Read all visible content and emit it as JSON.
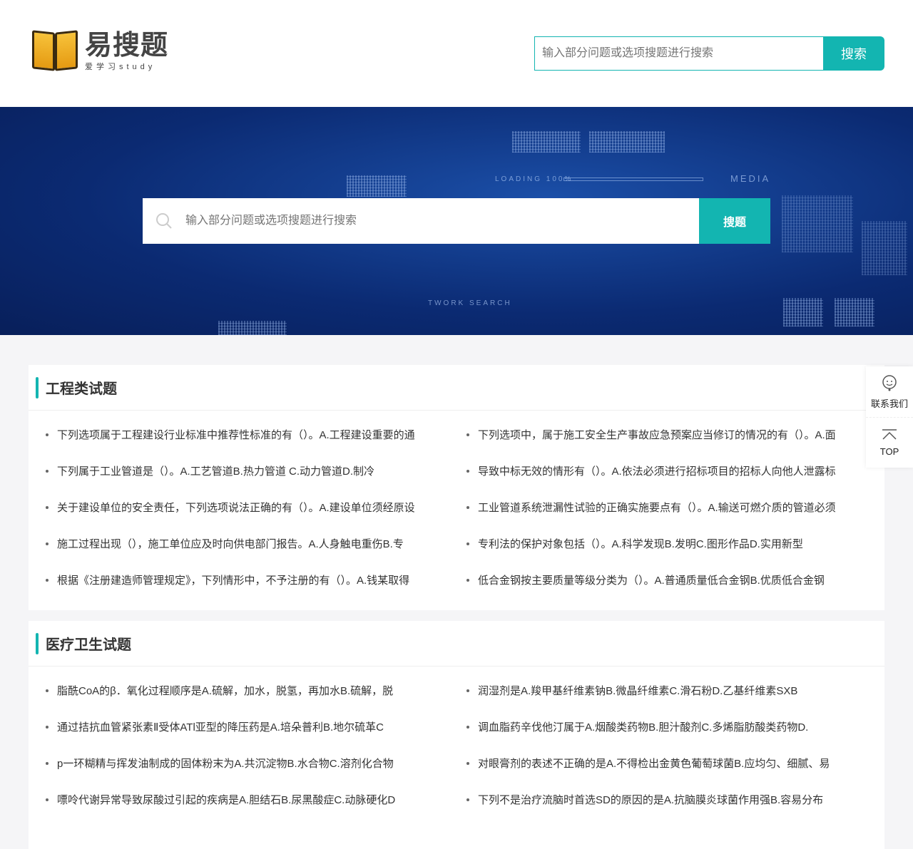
{
  "header": {
    "logo_title": "易搜题",
    "logo_subtitle": "爱学习study",
    "logo_mark": "YS",
    "search_placeholder": "输入部分问题或选项搜题进行搜索",
    "search_button": "搜索"
  },
  "banner": {
    "search_placeholder": "输入部分问题或选项搜题进行搜索",
    "search_button": "搜题",
    "deco_loading": "LOADING 100%",
    "deco_media": "MEDIA",
    "deco_network": "TWORK SEARCH"
  },
  "sections": [
    {
      "title": "工程类试题",
      "items": [
        "下列选项属于工程建设行业标准中推荐性标准的有（）。A.工程建设重要的通",
        "下列选项中，属于施工安全生产事故应急预案应当修订的情况的有（）。A.面",
        "下列属于工业管道是（）。A.工艺管道B.热力管道 C.动力管道D.制冷",
        "导致中标无效的情形有（）。A.依法必须进行招标项目的招标人向他人泄露标",
        "关于建设单位的安全责任，下列选项说法正确的有（）。A.建设单位须经原设",
        "工业管道系统泄漏性试验的正确实施要点有（）。A.输送可燃介质的管道必须",
        "施工过程出现（），施工单位应及时向供电部门报告。A.人身触电重伤B.专",
        "专利法的保护对象包括（）。A.科学发现B.发明C.图形作品D.实用新型",
        "根据《注册建造师管理规定》，下列情形中，不予注册的有（）。A.钱某取得",
        "低合金钢按主要质量等级分类为（）。A.普通质量低合金钢B.优质低合金钢"
      ]
    },
    {
      "title": "医疗卫生试题",
      "items": [
        "脂酰CoA的β．氧化过程顺序是A.硫解，加水，脱氢，再加水B.硫解，脱",
        "润湿剂是A.羧甲基纤维素钠B.微晶纤维素C.滑石粉D.乙基纤维素SXB",
        "通过拮抗血管紧张素Ⅱ受体ATl亚型的降压药是A.培朵普利B.地尔硫革C",
        "调血脂药辛伐他汀属于A.烟酸类药物B.胆汁酸剂C.多烯脂肪酸类药物D.",
        "p一环糊精与挥发油制成的固体粉末为A.共沉淀物B.水合物C.溶剂化合物",
        "对眼膏剂的表述不正确的是A.不得检出金黄色葡萄球菌B.应均匀、细腻、易",
        "嘌呤代谢异常导致尿酸过引起的疾病是A.胆结石B.尿黑酸症C.动脉硬化D",
        "下列不是治疗流脑时首选SD的原因的是A.抗脑膜炎球菌作用强B.容易分布"
      ]
    }
  ],
  "side": {
    "contact": "联系我们",
    "top": "TOP"
  },
  "colors": {
    "accent": "#13b5b1"
  }
}
